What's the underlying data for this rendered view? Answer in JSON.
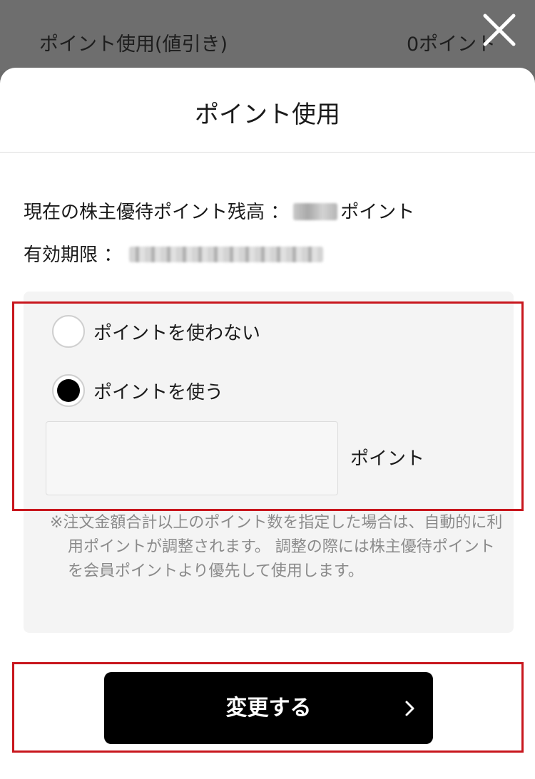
{
  "background": {
    "label": "ポイント使用(値引き)",
    "value": "0ポイント"
  },
  "close": {
    "icon": "close-icon"
  },
  "sheet": {
    "title": "ポイント使用",
    "balance_label": "現在の株主優待ポイント残高 ：",
    "balance_unit": "ポイント",
    "expiry_label": "有効期限 ："
  },
  "options": {
    "no_points_label": "ポイントを使わない",
    "use_points_label": "ポイントを使う",
    "selected": "use_points",
    "points_value": "",
    "points_unit": "ポイント",
    "note": "※注文金額合計以上のポイント数を指定した場合は、自動的に利用ポイントが調整されます。 調整の際には株主優待ポイントを会員ポイントより優先して使用します。"
  },
  "submit": {
    "label": "変更する"
  },
  "colors": {
    "highlight": "#c8161d",
    "button_bg": "#000000",
    "panel_bg": "#f4f4f4"
  }
}
